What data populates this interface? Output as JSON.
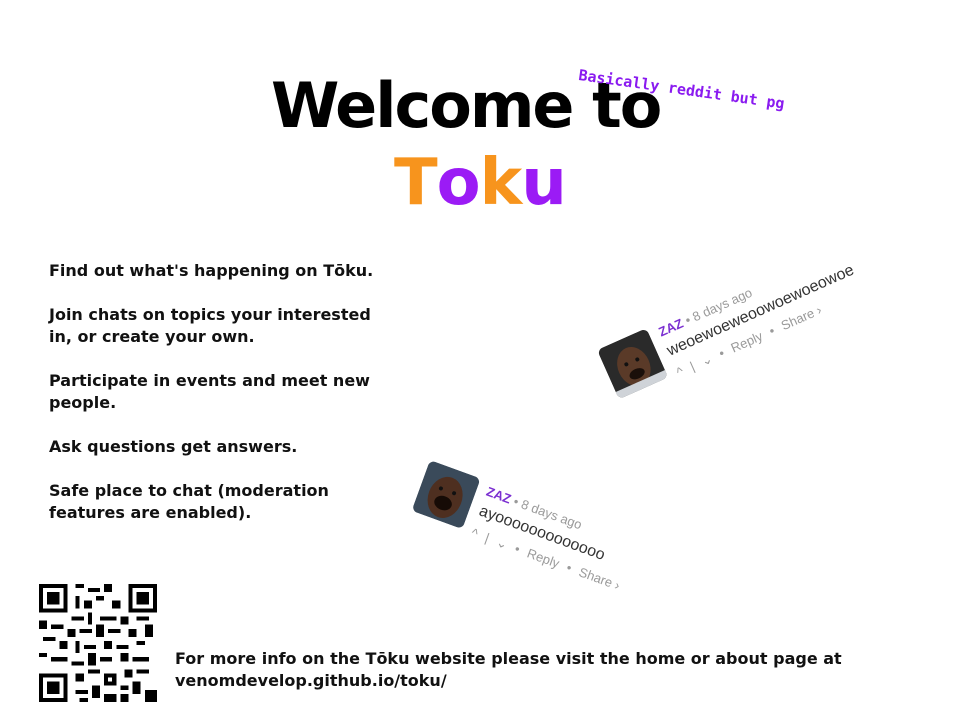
{
  "header": {
    "welcome": "Welcome to",
    "brand_letters": [
      "T",
      "o",
      "k",
      "u"
    ],
    "brand_colors": [
      "#f7941d",
      "#9b1bf5",
      "#f7941d",
      "#9b1bf5"
    ],
    "tagline": "Basically reddit but pg",
    "tagline_color": "#8a1bf0"
  },
  "features": [
    "Find out what's happening on Tōku.",
    "Join chats on topics your interested in, or create your own.",
    "Participate in events and meet new people.",
    "Ask questions get answers.",
    "Safe place to chat (moderation features are enabled)."
  ],
  "comments": [
    {
      "author": "ZAZ",
      "separator": "•",
      "time": "8 days ago",
      "body": "weoewoeweoowoewoeowoe",
      "upvote": "^",
      "divider": "|",
      "downvote": "⌄",
      "reply": "Reply",
      "share": "Share ›"
    },
    {
      "author": "ZAZ",
      "separator": "•",
      "time": "8 days ago",
      "body": "ayooooooooooooo",
      "upvote": "^",
      "divider": "|",
      "downvote": "⌄",
      "reply": "Reply",
      "share": "Share ›"
    }
  ],
  "footer": {
    "line1": "For more info on the Tōku website please visit the home or about page at",
    "line2": "venomdevelop.github.io/toku/",
    "qr_icon": "qr-code-icon"
  }
}
